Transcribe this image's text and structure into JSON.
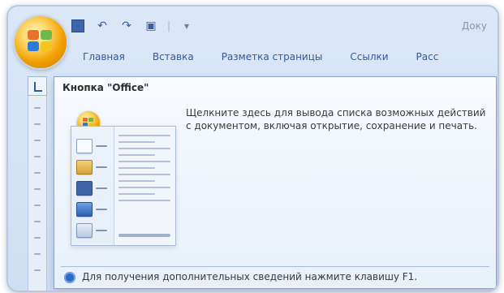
{
  "window": {
    "doc_title": "Доку"
  },
  "quick_access": {
    "save_icon": "save-icon",
    "undo_icon": "undo-icon",
    "redo_icon": "redo-icon",
    "dropdown_icon": "dropdown-icon"
  },
  "ribbon": {
    "tabs": [
      {
        "label": "Главная"
      },
      {
        "label": "Вставка"
      },
      {
        "label": "Разметка страницы"
      },
      {
        "label": "Ссылки"
      },
      {
        "label": "Расс"
      }
    ]
  },
  "tooltip": {
    "title": "Кнопка \"Office\"",
    "body": "Щелкните здесь для вывода списка возможных действий с документом, включая открытие, сохранение и печать.",
    "footer_text": "Для получения дополнительных сведений нажмите клавишу F1.",
    "footer_icon": "help-icon"
  },
  "preview": {
    "items": [
      {
        "icon": "new-icon"
      },
      {
        "icon": "open-icon"
      },
      {
        "icon": "save-icon"
      },
      {
        "icon": "save-as-icon"
      },
      {
        "icon": "print-icon"
      }
    ]
  },
  "colors": {
    "accent": "#2e5aa0",
    "tooltip_bg": "#eef4fb",
    "tooltip_border": "#8ba2c7"
  }
}
